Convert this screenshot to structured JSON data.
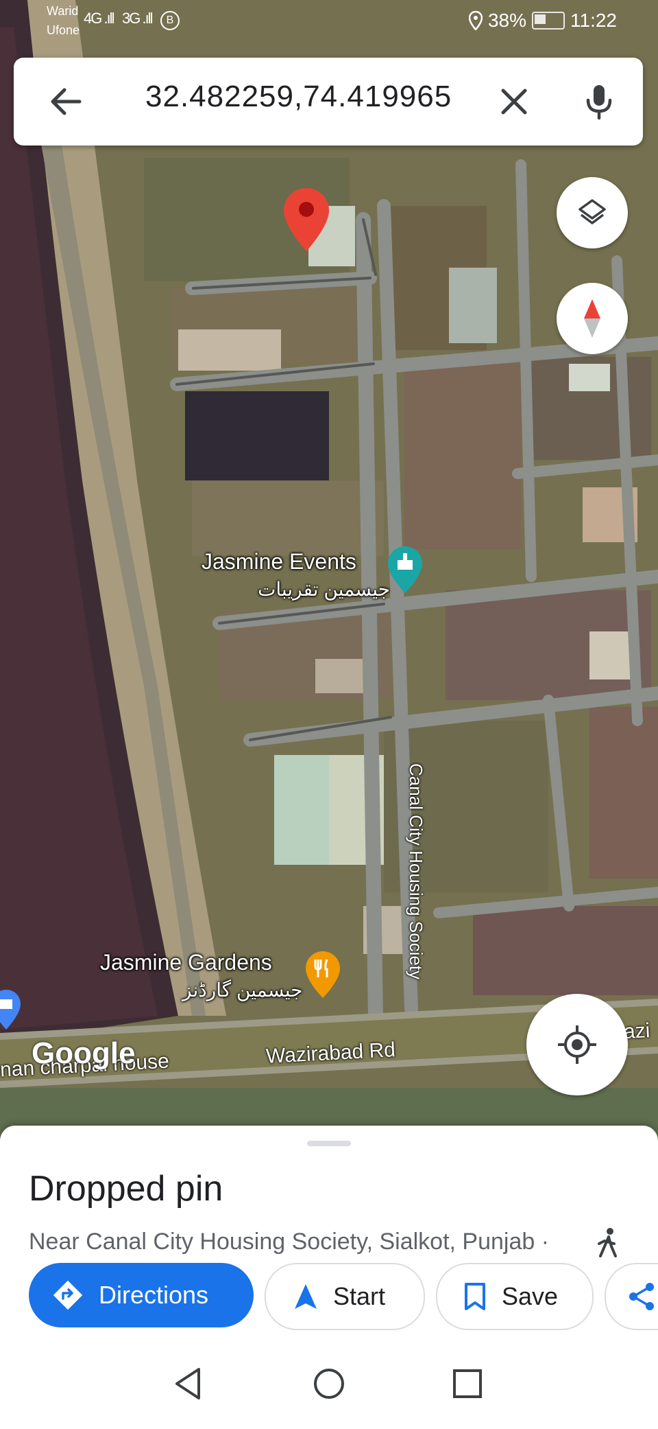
{
  "status_bar": {
    "carrier_1": "Warid",
    "carrier_2": "Ufone",
    "signal_1": "4G .ıll",
    "signal_2": "3G .ıll",
    "battery_percent": "38%",
    "time": "11:22"
  },
  "search": {
    "query": "32.482259,74.419965"
  },
  "map": {
    "labels": {
      "jasmine_events": "Jasmine Events",
      "jasmine_events_urdu": "جیسمین تقریبات",
      "jasmine_gardens": "Jasmine Gardens",
      "jasmine_gardens_urdu": "جیسمین گارڈنز",
      "canal_city": "Canal City Housing Society",
      "wazirabad_rd": "Wazirabad Rd",
      "partial_left": "nan charpai house",
      "partial_right": "azi"
    },
    "google_logo": "Google"
  },
  "place": {
    "title": "Dropped pin",
    "subtitle": "Near Canal City Housing Society, Sialkot, Punjab ·"
  },
  "actions": {
    "directions": "Directions",
    "start": "Start",
    "save": "Save"
  },
  "colors": {
    "accent": "#1a73e8",
    "pin": "#ea4335",
    "poi_teal": "#1aa6a6",
    "poi_orange": "#f29900"
  },
  "icons": [
    "back-arrow-icon",
    "clear-icon",
    "mic-icon",
    "layers-icon",
    "compass-icon",
    "my-location-icon",
    "directions-icon",
    "navigation-icon",
    "bookmark-icon",
    "share-icon",
    "walk-icon"
  ]
}
